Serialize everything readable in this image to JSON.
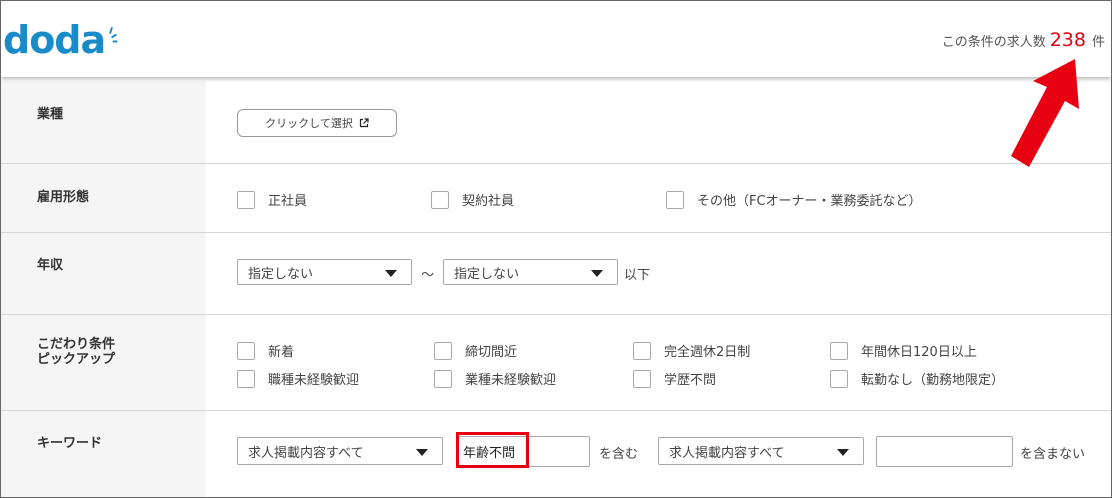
{
  "header": {
    "logo": "doda",
    "count_prefix": "この条件の求人数",
    "count_value": "238",
    "count_suffix": "件",
    "count_color": "#e60012",
    "brand_color": "#1a8bc9"
  },
  "rows": {
    "industry": {
      "label": "業種",
      "button_label": "クリックして選択",
      "button_icon": "external-link-icon"
    },
    "employment": {
      "label": "雇用形態",
      "options": [
        "正社員",
        "契約社員",
        "その他（FCオーナー・業務委託など）"
      ]
    },
    "salary": {
      "label": "年収",
      "min_value": "指定しない",
      "separator": "〜",
      "max_value": "指定しない",
      "suffix": "以下"
    },
    "features": {
      "label_line1": "こだわり条件",
      "label_line2": "ピックアップ",
      "options": [
        "新着",
        "締切間近",
        "完全週休2日制",
        "年間休日120日以上",
        "職種未経験歓迎",
        "業種未経験歓迎",
        "学歴不問",
        "転勤なし（勤務地限定）"
      ]
    },
    "keyword": {
      "label": "キーワード",
      "include_scope": "求人掲載内容すべて",
      "include_value": "年齢不問",
      "include_suffix": "を含む",
      "exclude_scope": "求人掲載内容すべて",
      "exclude_value": "",
      "exclude_suffix": "を含まない"
    }
  },
  "annotation": {
    "highlight_color": "#e60012",
    "arrow_color": "#e60012"
  }
}
